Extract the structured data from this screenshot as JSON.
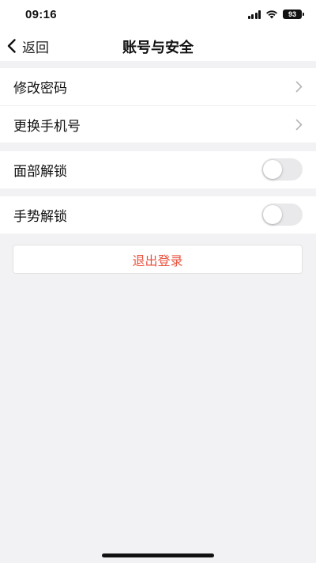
{
  "status_bar": {
    "time": "09:16",
    "battery": "93"
  },
  "nav": {
    "back_label": "返回",
    "title": "账号与安全"
  },
  "groups": {
    "account": {
      "change_password": "修改密码",
      "change_phone": "更换手机号"
    },
    "face_unlock": {
      "label": "面部解锁",
      "enabled": false
    },
    "gesture_unlock": {
      "label": "手势解锁",
      "enabled": false
    }
  },
  "logout": {
    "label": "退出登录",
    "color": "#e8533f"
  },
  "colors": {
    "background": "#f2f2f4",
    "toggle_off": "#e9e9eb",
    "chevron": "#b5b5b8"
  }
}
